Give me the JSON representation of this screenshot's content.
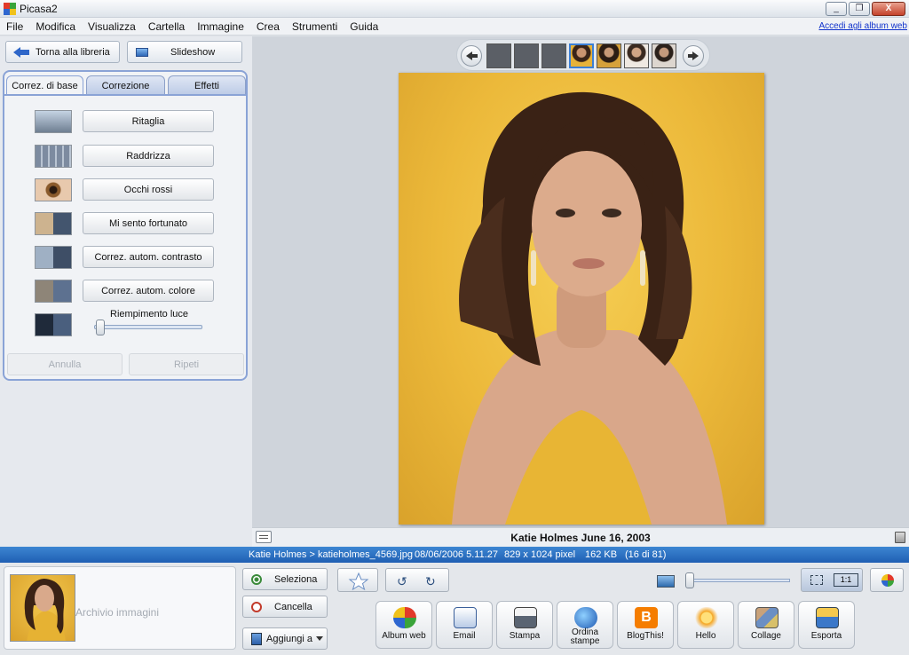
{
  "window": {
    "title": "Picasa2",
    "buttons": [
      "_",
      "❐",
      "X"
    ]
  },
  "menu": {
    "items": [
      "File",
      "Modifica",
      "Visualizza",
      "Cartella",
      "Immagine",
      "Crea",
      "Strumenti",
      "Guida"
    ],
    "link": "Accedi agli album web"
  },
  "left_panel": {
    "back_button": "Torna alla libreria",
    "slideshow_button": "Slideshow",
    "tabs": [
      "Correz. di base",
      "Correzione",
      "Effetti"
    ],
    "tools": [
      "Ritaglia",
      "Raddrizza",
      "Occhi rossi",
      "Mi sento fortunato",
      "Correz. autom. contrasto",
      "Correz. autom. colore"
    ],
    "fill_light_label": "Riempimento luce",
    "fill_light_value": 0,
    "undo_label": "Annulla",
    "redo_label": "Ripeti"
  },
  "viewer": {
    "caption": "Katie Holmes June 16, 2003"
  },
  "status": {
    "path": "Katie Holmes > katieholmes_4569.jpg",
    "date": "08/06/2006 5.11.27",
    "dimensions": "829 x 1024 pixel",
    "size": "162 KB",
    "position": "(16 di 81)"
  },
  "tray": {
    "label": "Archivio immagini",
    "select_button": "Seleziona",
    "clear_button": "Cancella",
    "add_button": "Aggiungi a",
    "view_1to1": "1:1",
    "actions": [
      "Album web",
      "Email",
      "Stampa",
      "Ordina stampe",
      "BlogThis!",
      "Hello",
      "Collage",
      "Esporta"
    ]
  },
  "colors": {
    "accent": "#2f67c9",
    "statusbar": "#2a6fc2",
    "photo_bg": "#ecb93a"
  }
}
